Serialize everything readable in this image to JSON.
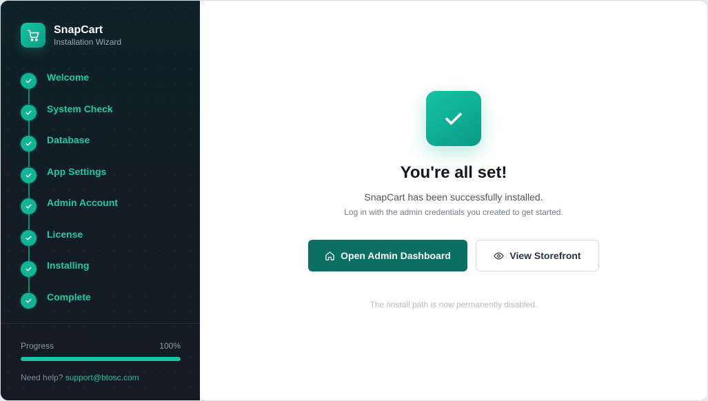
{
  "brand": {
    "name": "SnapCart",
    "subtitle": "Installation Wizard",
    "logo_icon": "shopping-cart-icon"
  },
  "steps": [
    {
      "label": "Welcome",
      "status": "complete"
    },
    {
      "label": "System Check",
      "status": "complete"
    },
    {
      "label": "Database",
      "status": "complete"
    },
    {
      "label": "App Settings",
      "status": "complete"
    },
    {
      "label": "Admin Account",
      "status": "complete"
    },
    {
      "label": "License",
      "status": "complete"
    },
    {
      "label": "Installing",
      "status": "complete"
    },
    {
      "label": "Complete",
      "status": "complete"
    }
  ],
  "progress": {
    "label": "Progress",
    "value_text": "100%",
    "fraction": 1.0
  },
  "help": {
    "prefix": "Need help?",
    "email": "support@btosc.com"
  },
  "main": {
    "badge_icon": "checkmark-icon",
    "title": "You're all set!",
    "subtitle": "SnapCart has been successfully installed.",
    "hint": "Log in with the admin credentials you created to get started.",
    "primary_button": {
      "label": "Open Admin Dashboard",
      "icon": "home-icon"
    },
    "secondary_button": {
      "label": "View Storefront",
      "icon": "eye-icon"
    },
    "footnote": "The /install path is now permanently disabled."
  },
  "colors": {
    "accent": "#19c3a3",
    "primary_button": "#0b6f63",
    "sidebar_bg": "#121c24"
  }
}
